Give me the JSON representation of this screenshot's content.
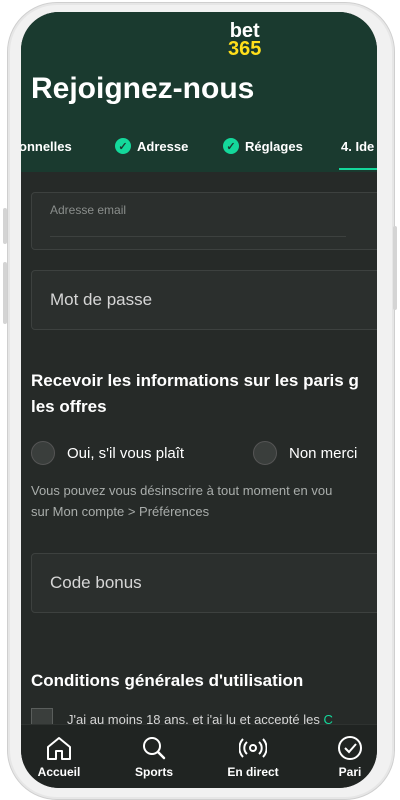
{
  "brand": {
    "line1": "bet",
    "line2": "365",
    "accent": "#ffdf1b",
    "header_bg": "#1a3a2f",
    "success": "#14d89b"
  },
  "page": {
    "title": "Rejoignez-nous"
  },
  "steps": [
    {
      "label": "onnelles",
      "done": false
    },
    {
      "label": "Adresse",
      "done": true
    },
    {
      "label": "Réglages",
      "done": true
    },
    {
      "label": "4. Ide",
      "done": false,
      "active": true
    }
  ],
  "form": {
    "email_placeholder": "Adresse email",
    "password_placeholder": "Mot de passe",
    "bonus_placeholder": "Code bonus"
  },
  "marketing": {
    "heading_line1": "Recevoir les informations sur les paris g",
    "heading_line2": "les offres",
    "yes_label": "Oui, s'il vous plaît",
    "no_label": "Non merci",
    "note_line1": "Vous pouvez vous désinscrire à tout moment en vou",
    "note_line2": "sur Mon compte > Préférences"
  },
  "terms": {
    "heading": "Conditions générales d'utilisation",
    "checkbox_text": "J'ai au moins 18 ans, et j'ai lu et accepté les ",
    "checkbox_link": "C"
  },
  "tabbar": [
    {
      "label": "Accueil",
      "icon": "home-icon"
    },
    {
      "label": "Sports",
      "icon": "search-icon"
    },
    {
      "label": "En direct",
      "icon": "live-icon"
    },
    {
      "label": "Pari",
      "icon": "check-circle-icon"
    }
  ]
}
